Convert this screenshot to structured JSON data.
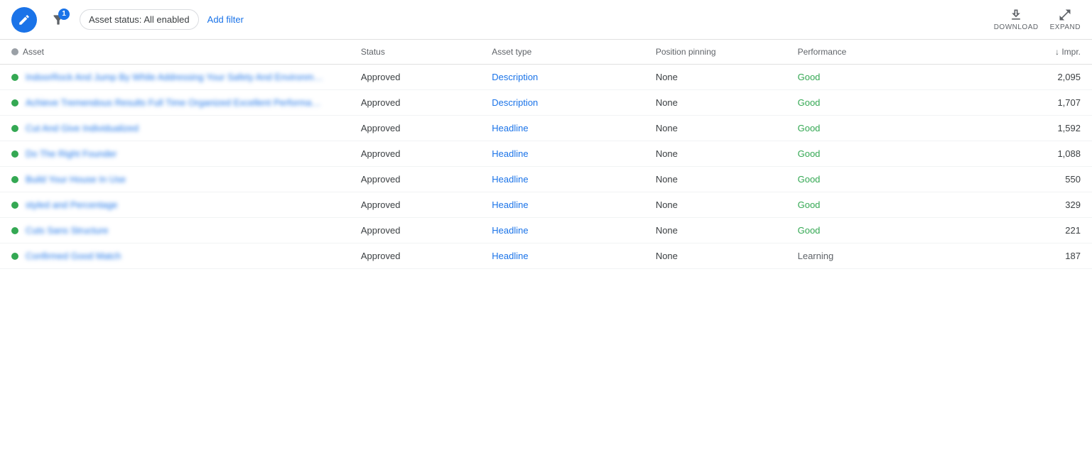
{
  "toolbar": {
    "edit_icon": "pencil",
    "filter_count": "1",
    "status_filter_label": "Asset status: All enabled",
    "add_filter_label": "Add filter",
    "download_label": "DOWNLOAD",
    "expand_label": "EXPAND"
  },
  "table": {
    "columns": [
      {
        "key": "asset",
        "label": "Asset"
      },
      {
        "key": "status",
        "label": "Status"
      },
      {
        "key": "asset_type",
        "label": "Asset type"
      },
      {
        "key": "position_pinning",
        "label": "Position pinning"
      },
      {
        "key": "performance",
        "label": "Performance"
      },
      {
        "key": "impressions",
        "label": "Impr."
      }
    ],
    "rows": [
      {
        "asset": "IndoorRock And Jump By While Addressing Your Safety And Environmental Challenge",
        "status": "Approved",
        "asset_type": "Description",
        "position_pinning": "None",
        "performance": "Good",
        "impressions": "2,095",
        "dot_color": "green"
      },
      {
        "asset": "Achieve Tremendous Results Full Time Organized Excellent Performance",
        "status": "Approved",
        "asset_type": "Description",
        "position_pinning": "None",
        "performance": "Good",
        "impressions": "1,707",
        "dot_color": "green"
      },
      {
        "asset": "Cut And Give Individualized",
        "status": "Approved",
        "asset_type": "Headline",
        "position_pinning": "None",
        "performance": "Good",
        "impressions": "1,592",
        "dot_color": "green"
      },
      {
        "asset": "Do The Right Founder",
        "status": "Approved",
        "asset_type": "Headline",
        "position_pinning": "None",
        "performance": "Good",
        "impressions": "1,088",
        "dot_color": "green"
      },
      {
        "asset": "Build Your House In Use",
        "status": "Approved",
        "asset_type": "Headline",
        "position_pinning": "None",
        "performance": "Good",
        "impressions": "550",
        "dot_color": "green"
      },
      {
        "asset": "styled and Percentage",
        "status": "Approved",
        "asset_type": "Headline",
        "position_pinning": "None",
        "performance": "Good",
        "impressions": "329",
        "dot_color": "green"
      },
      {
        "asset": "Cuts Sans Structure",
        "status": "Approved",
        "asset_type": "Headline",
        "position_pinning": "None",
        "performance": "Good",
        "impressions": "221",
        "dot_color": "green"
      },
      {
        "asset": "Confirmed Good Match",
        "status": "Approved",
        "asset_type": "Headline",
        "position_pinning": "None",
        "performance": "Learning",
        "impressions": "187",
        "dot_color": "green"
      }
    ]
  }
}
